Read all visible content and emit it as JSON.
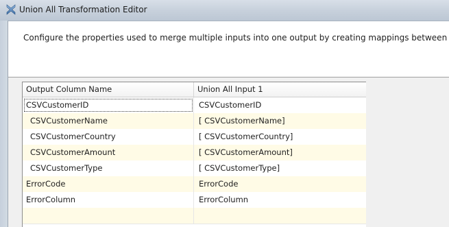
{
  "window": {
    "title": "Union All Transformation Editor"
  },
  "header": {
    "description": "Configure the properties used to merge multiple inputs into one output by creating mappings between columns."
  },
  "grid": {
    "columns": [
      "Output Column Name",
      "Union All Input 1"
    ],
    "rows": [
      {
        "output": "CSVCustomerID",
        "input": "CSVCustomerID"
      },
      {
        "output": "CSVCustomerName",
        "input": "[ CSVCustomerName]"
      },
      {
        "output": "CSVCustomerCountry",
        "input": "[ CSVCustomerCountry]"
      },
      {
        "output": "CSVCustomerAmount",
        "input": "[ CSVCustomerAmount]"
      },
      {
        "output": "CSVCustomerType",
        "input": "[ CSVCustomerType]"
      },
      {
        "output": "ErrorCode",
        "input": "ErrorCode"
      },
      {
        "output": "ErrorColumn",
        "input": "ErrorColumn"
      },
      {
        "output": "",
        "input": ""
      }
    ]
  },
  "colors": {
    "alt_row": "#fffbe6",
    "title_bar": "#c9d2dd"
  },
  "icons": {
    "app": "ssis-transform-icon"
  }
}
